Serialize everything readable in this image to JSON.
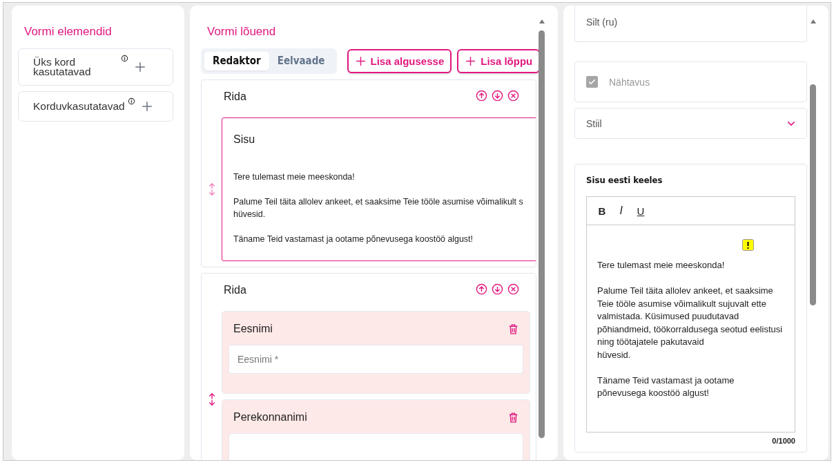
{
  "palette": {
    "title": "Vormi elemendid",
    "items": [
      {
        "label": "Üks kord kasutatavad"
      },
      {
        "label": "Korduvkasutatavad"
      }
    ]
  },
  "canvas": {
    "title": "Vormi lõuend",
    "tabs": [
      {
        "label": "Redaktor",
        "selected": true
      },
      {
        "label": "Eelvaade",
        "selected": false
      }
    ],
    "buttons": [
      {
        "label": "Lisa algusesse"
      },
      {
        "label": "Lisa lõppu"
      }
    ],
    "rows": [
      {
        "title": "Rida",
        "elements": [
          {
            "kind": "content",
            "title": "Sisu",
            "paragraphs": [
              "Tere tulemast meie meeskonda!",
              "Palume Teil täita allolev ankeet, et saaksime Teie tööle asumise võimalikult s\nhüvesid.",
              "Täname Teid vastamast ja ootame põnevusega koostöö algust!"
            ]
          }
        ]
      },
      {
        "title": "Rida",
        "elements": [
          {
            "kind": "field",
            "title": "Eesnimi",
            "placeholder": "Eesnimi *"
          },
          {
            "kind": "field",
            "title": "Perekonnanimi"
          }
        ]
      }
    ]
  },
  "properties": {
    "fields": [
      {
        "kind": "text",
        "placeholder": "Silt (ru)"
      },
      {
        "kind": "checkbox",
        "label": "Nähtavus",
        "checked": true,
        "disabled": true
      },
      {
        "kind": "select",
        "placeholder": "Stiil"
      }
    ],
    "editor": {
      "title": "Sisu eesti keeles",
      "toolbar": [
        "B",
        "I",
        "U"
      ],
      "paragraphs": [
        "Tere tulemast meie meeskonda!",
        "Palume Teil täita allolev ankeet, et saaksime Teie tööle asumise võimalikult sujuvalt ette valmistada. Küsimused puudutavad põhiandmeid, töökorraldusega seotud eelistusi ning töötajatele pakutavaid\nhüvesid.",
        "Täname Teid vastamast ja ootame põnevusega koostöö algust!"
      ],
      "counter": "0/1000"
    }
  }
}
